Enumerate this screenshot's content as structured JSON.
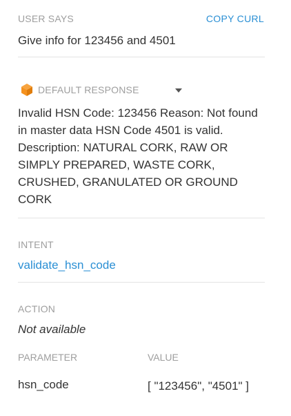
{
  "user_says": {
    "label": "USER SAYS",
    "copy_curl_label": "COPY CURL",
    "text": "Give info for 123456 and 4501"
  },
  "response": {
    "icon": "cube-icon",
    "label": "DEFAULT RESPONSE",
    "text": "Invalid HSN Code: 123456 Reason: Not found in master data HSN Code 4501 is valid. Description: NATURAL CORK, RAW OR SIMPLY PREPARED, WASTE CORK, CRUSHED, GRANULATED OR GROUND CORK"
  },
  "intent": {
    "label": "INTENT",
    "value": "validate_hsn_code"
  },
  "action": {
    "label": "ACTION",
    "value": "Not available"
  },
  "parameters": {
    "headers": [
      "PARAMETER",
      "VALUE"
    ],
    "rows": [
      {
        "name": "hsn_code",
        "value": "[ \"123456\", \"4501\" ]"
      }
    ]
  },
  "colors": {
    "accent": "#2a8fd4",
    "label_gray": "#9e9e9e",
    "icon_orange": "#f5921e"
  }
}
